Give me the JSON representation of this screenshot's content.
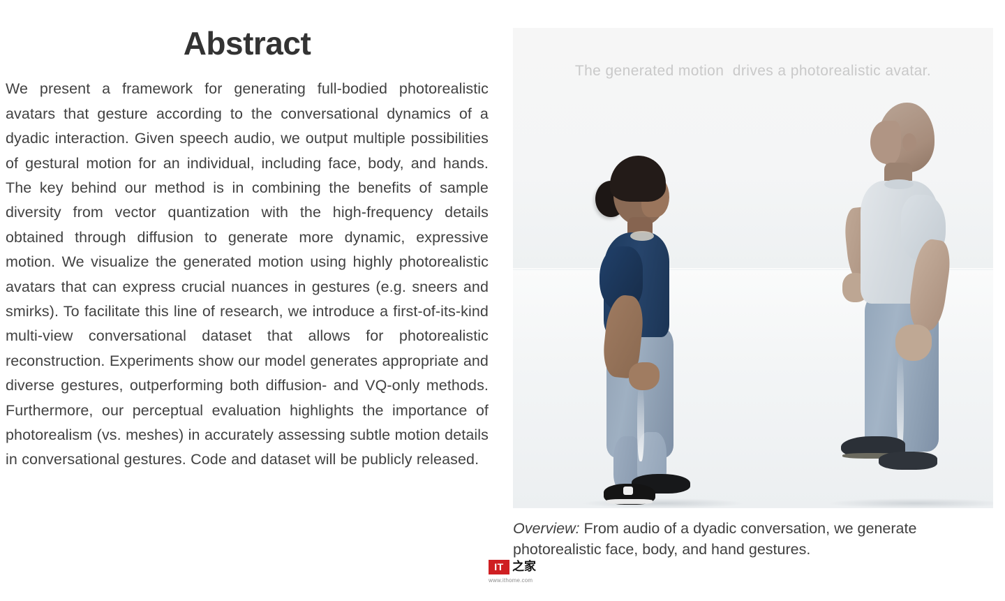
{
  "abstract": {
    "title": "Abstract",
    "body": "We present a framework for generating full-bodied photorealistic avatars that gesture according to the conversational dynamics of a dyadic interaction. Given speech audio, we output multiple possibilities of gestural motion for an individual, including face, body, and hands. The key behind our method is in combining the benefits of sample diversity from vector quantization with the high-frequency details obtained through diffusion to generate more dynamic, expressive motion. We visualize the generated motion using highly photorealistic avatars that can express crucial nuances in gestures (e.g. sneers and smirks). To facilitate this line of research, we introduce a first-of-its-kind multi-view conversational dataset that allows for photorealistic reconstruction. Experiments show our model generates appropriate and diverse gestures, outperforming both diffusion- and VQ-only methods. Furthermore, our perceptual evaluation highlights the importance of photorealism (vs. meshes) in accurately assessing subtle motion details in conversational gestures. Code and dataset will be publicly released."
  },
  "figure": {
    "overlay_text": "The generated motion  drives a photorealistic avatar.",
    "caption_lead": "Overview:",
    "caption_rest": " From audio of a dyadic conversation, we generate photorealistic face, body, and hand gestures.",
    "subjects": [
      {
        "name": "left-avatar-woman",
        "description": "Woman facing right, dark hair tied in a low bun, navy blue short-sleeve t-shirt, light blue jeans, black sneakers"
      },
      {
        "name": "right-avatar-man",
        "description": "Man facing left, shaved head, light gray short-sleeve t-shirt, light blue jeans, dark slip-on shoes"
      }
    ],
    "colors": {
      "background": "#f7f7f7",
      "wall": "#f4f5f6",
      "floor": "#eceff1",
      "woman_shirt": "#27456c",
      "man_shirt": "#d4dadf",
      "jeans": "#9fb0c2",
      "overlay_text": "#c9c9c9"
    }
  },
  "watermark": {
    "mark": "IT",
    "cjk": "之家",
    "url": "www.ithome.com",
    "brand_color": "#cf1f22"
  }
}
